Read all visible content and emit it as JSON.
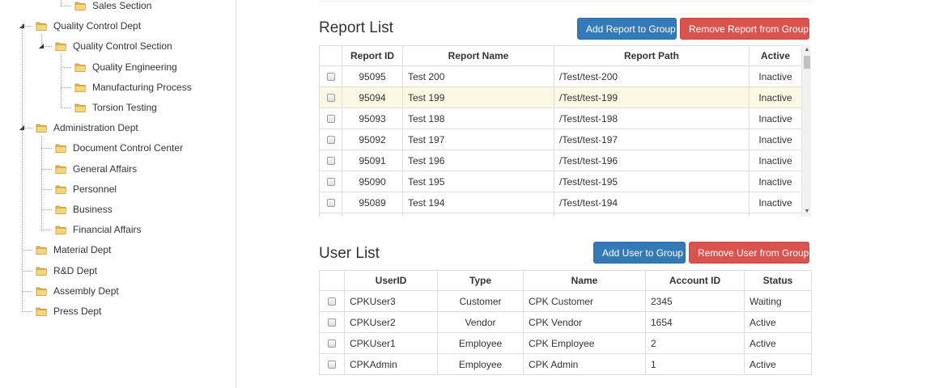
{
  "tree": {
    "nodes": [
      {
        "label": "Sales Section",
        "level": 3,
        "toggle": ""
      },
      {
        "label": "Quality Control Dept",
        "level": 1,
        "toggle": "expanded"
      },
      {
        "label": "Quality Control Section",
        "level": 2,
        "toggle": "expanded"
      },
      {
        "label": "Quality Engineering",
        "level": 3,
        "toggle": ""
      },
      {
        "label": "Manufacturing Process",
        "level": 3,
        "toggle": ""
      },
      {
        "label": "Torsion Testing",
        "level": 3,
        "toggle": ""
      },
      {
        "label": "Administration Dept",
        "level": 1,
        "toggle": "expanded"
      },
      {
        "label": "Document Control Center",
        "level": 2,
        "toggle": ""
      },
      {
        "label": "General Affairs",
        "level": 2,
        "toggle": ""
      },
      {
        "label": "Personnel",
        "level": 2,
        "toggle": ""
      },
      {
        "label": "Business",
        "level": 2,
        "toggle": ""
      },
      {
        "label": "Financial Affairs",
        "level": 2,
        "toggle": ""
      },
      {
        "label": "Material Dept",
        "level": 1,
        "toggle": ""
      },
      {
        "label": "R&D Dept",
        "level": 1,
        "toggle": ""
      },
      {
        "label": "Assembly Dept",
        "level": 1,
        "toggle": ""
      },
      {
        "label": "Press Dept",
        "level": 1,
        "toggle": ""
      }
    ]
  },
  "report": {
    "title": "Report List",
    "add_label": "Add Report to Group",
    "remove_label": "Remove Report from Group",
    "columns": [
      "Report ID",
      "Report Name",
      "Report Path",
      "Active"
    ],
    "rows": [
      {
        "id": "95095",
        "name": "Test 200",
        "path": "/Test/test-200",
        "active": "Inactive"
      },
      {
        "id": "95094",
        "name": "Test 199",
        "path": "/Test/test-199",
        "active": "Inactive",
        "highlight": true
      },
      {
        "id": "95093",
        "name": "Test 198",
        "path": "/Test/test-198",
        "active": "Inactive"
      },
      {
        "id": "95092",
        "name": "Test 197",
        "path": "/Test/test-197",
        "active": "Inactive"
      },
      {
        "id": "95091",
        "name": "Test 196",
        "path": "/Test/test-196",
        "active": "Inactive"
      },
      {
        "id": "95090",
        "name": "Test 195",
        "path": "/Test/test-195",
        "active": "Inactive"
      },
      {
        "id": "95089",
        "name": "Test 194",
        "path": "/Test/test-194",
        "active": "Inactive"
      }
    ]
  },
  "users": {
    "title": "User List",
    "add_label": "Add User to Group",
    "remove_label": "Remove User from Group",
    "columns": [
      "UserID",
      "Type",
      "Name",
      "Account ID",
      "Status"
    ],
    "rows": [
      {
        "userid": "CPKUser3",
        "type": "Customer",
        "name": "CPK Customer",
        "account": "2345",
        "status": "Waiting"
      },
      {
        "userid": "CPKUser2",
        "type": "Vendor",
        "name": "CPK Vendor",
        "account": "1654",
        "status": "Active"
      },
      {
        "userid": "CPKUser1",
        "type": "Employee",
        "name": "CPK Employee",
        "account": "2",
        "status": "Active"
      },
      {
        "userid": "CPKAdmin",
        "type": "Employee",
        "name": "CPK Admin",
        "account": "1",
        "status": "Active"
      }
    ]
  },
  "colors": {
    "primary": "#337ab7",
    "danger": "#d9534f",
    "row_highlight": "#fcf8e3"
  },
  "icons": {
    "folder": "folder-icon",
    "expanded": "collapse-toggle-icon",
    "checkbox": "checkbox"
  }
}
